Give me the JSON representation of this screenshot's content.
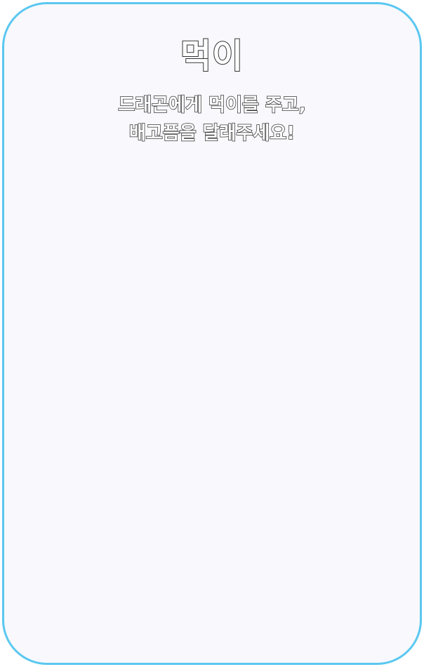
{
  "card": {
    "title": "먹이",
    "description_lines": [
      "드래곤에게 먹이를 주고,",
      "배고픔을 달래주세요!"
    ]
  },
  "colors": {
    "border": "#5ac8f0",
    "background": "#f8f8fd",
    "text_fill": "#ffffff",
    "text_outline": "#333333"
  }
}
